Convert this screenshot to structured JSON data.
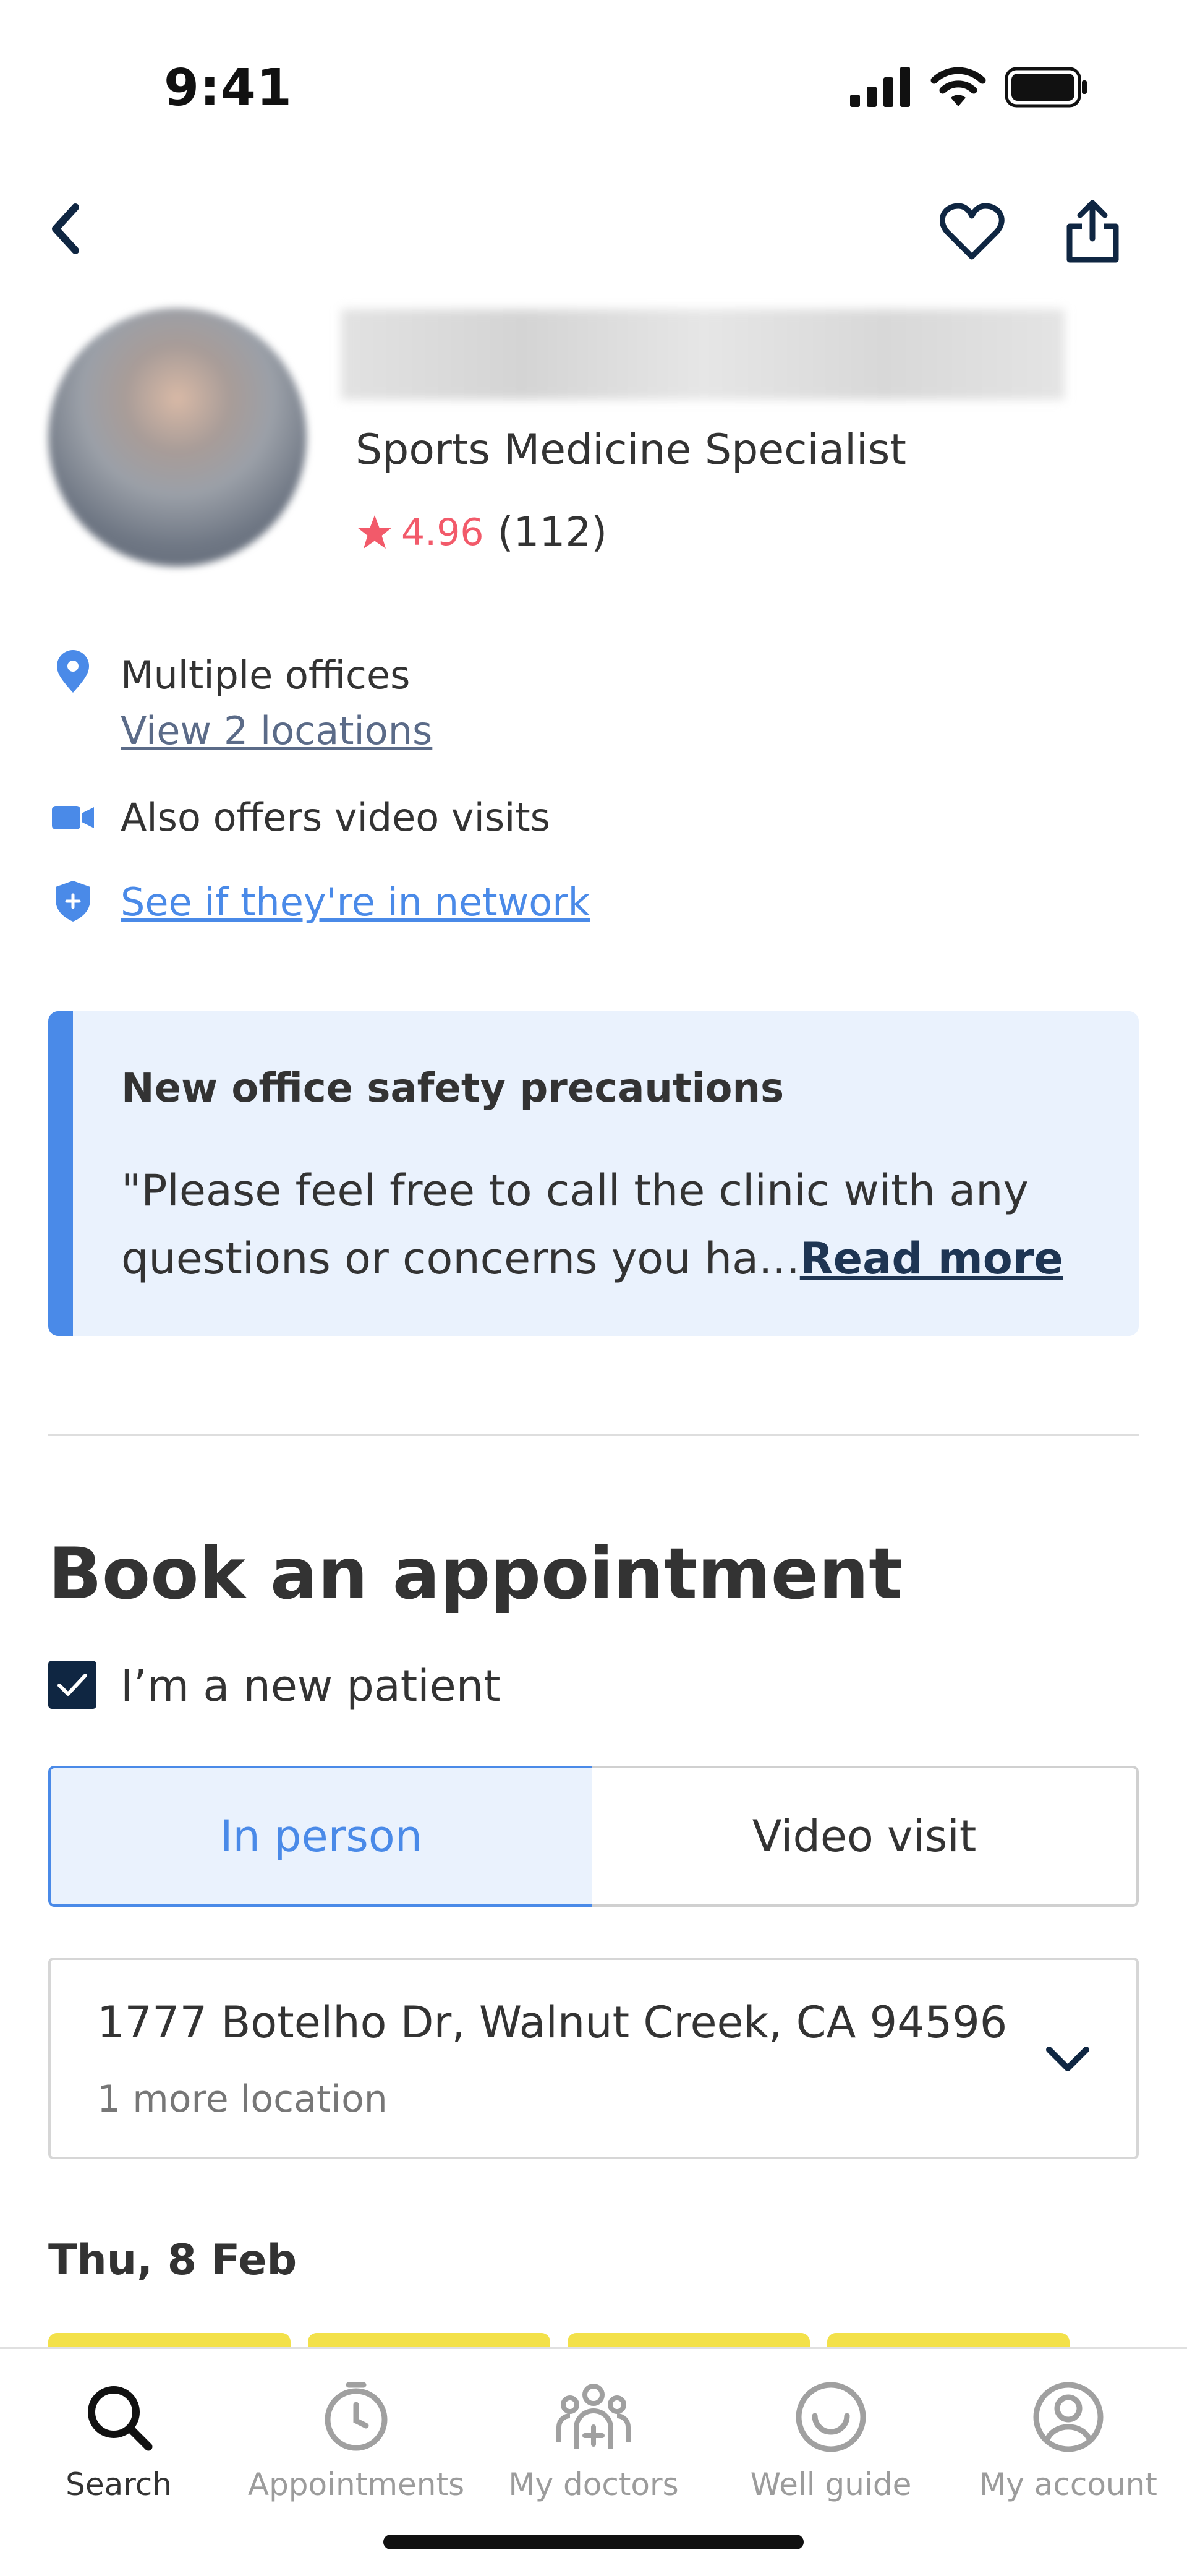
{
  "status_bar": {
    "time": "9:41"
  },
  "doctor": {
    "specialty": "Sports Medicine Specialist",
    "rating": "4.96",
    "review_count": "(112)"
  },
  "info": {
    "offices_label": "Multiple offices",
    "view_locations": "View 2 locations",
    "video_label": "Also offers video visits",
    "network_link": "See if they're in network"
  },
  "notice": {
    "title": "New office safety precautions",
    "body": "\"Please feel free to call the clinic with any questions or concerns you ha...",
    "read_more": "Read more"
  },
  "booking": {
    "title": "Book an appointment",
    "new_patient_label": "I’m a new patient",
    "new_patient_checked": true,
    "visit_types": [
      "In person",
      "Video visit"
    ],
    "selected_visit_type": "In person",
    "location_address": "1777 Botelho Dr, Walnut Creek, CA 94596",
    "location_more": "1 more location",
    "date": "Thu, 8 Feb"
  },
  "tabs": [
    {
      "label": "Search",
      "icon": "search-icon",
      "active": true
    },
    {
      "label": "Appointments",
      "icon": "clock-icon",
      "active": false
    },
    {
      "label": "My doctors",
      "icon": "doctors-icon",
      "active": false
    },
    {
      "label": "Well guide",
      "icon": "smile-icon",
      "active": false
    },
    {
      "label": "My account",
      "icon": "account-icon",
      "active": false
    }
  ],
  "colors": {
    "accent_blue": "#4a8ae8",
    "navy": "#0f2642",
    "rating_red": "#f25a6a",
    "notice_bg": "#eaf2fd",
    "slot_yellow": "#f3e14a"
  }
}
